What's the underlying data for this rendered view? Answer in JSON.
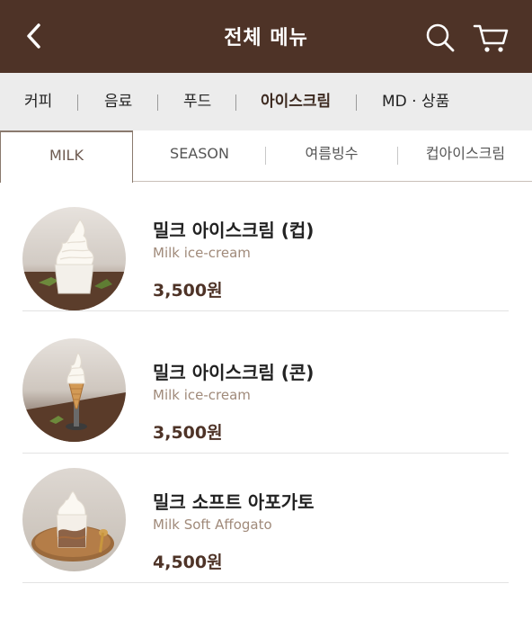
{
  "header": {
    "title": "전체 메뉴",
    "back_icon": "chevron-left-icon",
    "search_icon": "search-icon",
    "cart_icon": "cart-icon",
    "background_color": "#4e3327"
  },
  "categories": {
    "items": [
      {
        "label": "커피"
      },
      {
        "label": "음료"
      },
      {
        "label": "푸드"
      },
      {
        "label": "아이스크림"
      },
      {
        "label": "MD · 상품"
      }
    ],
    "active": "아이스크림"
  },
  "sub_tabs": {
    "items": [
      {
        "label": "MILK"
      },
      {
        "label": "SEASON"
      },
      {
        "label": "여름빙수"
      },
      {
        "label": "컵아이스크림"
      }
    ],
    "active": "MILK"
  },
  "products": [
    {
      "name": "밀크 아이스크림 (컵)",
      "name_en": "Milk ice-cream",
      "price": "3,500원"
    },
    {
      "name": "밀크 아이스크림 (콘)",
      "name_en": "Milk ice-cream",
      "price": "3,500원"
    },
    {
      "name": "밀크 소프트 아포가토",
      "name_en": "Milk Soft Affogato",
      "price": "4,500원"
    }
  ]
}
